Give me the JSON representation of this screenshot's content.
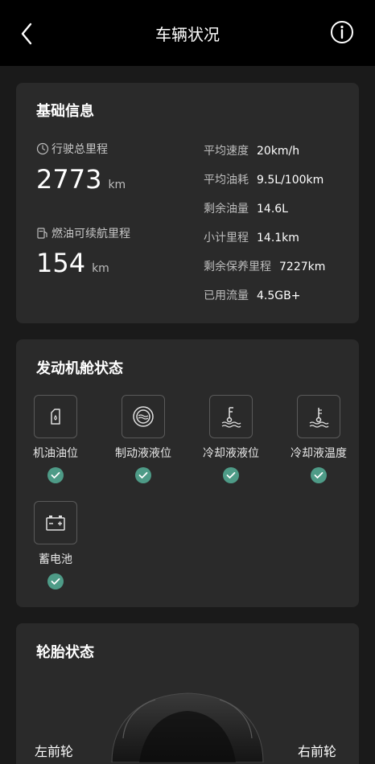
{
  "header": {
    "title": "车辆状况"
  },
  "basic": {
    "title": "基础信息",
    "total_mileage": {
      "label": "行驶总里程",
      "value": "2773",
      "unit": "km"
    },
    "range": {
      "label": "燃油可续航里程",
      "value": "154",
      "unit": "km"
    },
    "stats": [
      {
        "key": "平均速度",
        "value": "20km/h"
      },
      {
        "key": "平均油耗",
        "value": "9.5L/100km"
      },
      {
        "key": "剩余油量",
        "value": "14.6L"
      },
      {
        "key": "小计里程",
        "value": "14.1km"
      },
      {
        "key": "剩余保养里程",
        "value": "7227km"
      },
      {
        "key": "已用流量",
        "value": "4.5GB+"
      }
    ]
  },
  "engine": {
    "title": "发动机舱状态",
    "items": [
      {
        "label": "机油油位",
        "icon": "oil-can-icon"
      },
      {
        "label": "制动液液位",
        "icon": "brake-fluid-icon"
      },
      {
        "label": "冷却液液位",
        "icon": "coolant-level-icon"
      },
      {
        "label": "冷却液温度",
        "icon": "coolant-temp-icon"
      },
      {
        "label": "蓄电池",
        "icon": "battery-icon"
      }
    ],
    "ok_color": "#4e9b87"
  },
  "tires": {
    "title": "轮胎状态",
    "front_left": "左前轮",
    "front_right": "右前轮"
  }
}
